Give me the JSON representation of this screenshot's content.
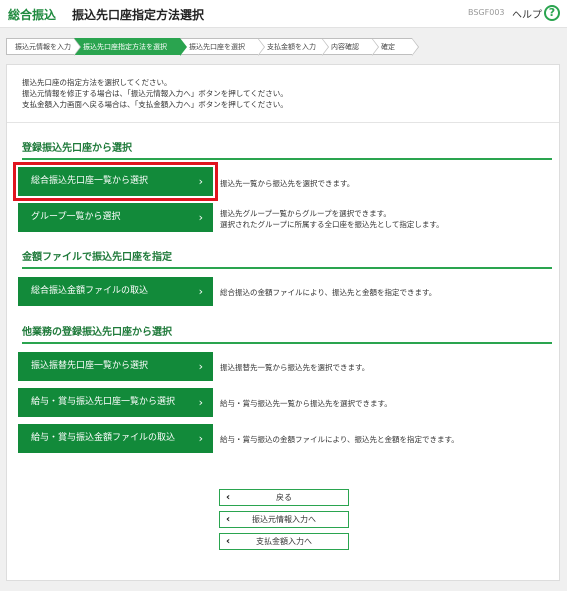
{
  "header": {
    "app_name": "総合振込",
    "page_title": "振込先口座指定方法選択",
    "screen_code": "BSGF003",
    "help_label": "ヘルプ",
    "help_icon": "?"
  },
  "steps": [
    {
      "label": "振込元情報を入力",
      "active": false
    },
    {
      "label": "振込先口座指定方法を選択",
      "active": true
    },
    {
      "label": "振込先口座を選択",
      "active": false
    },
    {
      "label": "支払金額を入力",
      "active": false
    },
    {
      "label": "内容確認",
      "active": false
    },
    {
      "label": "確定",
      "active": false
    }
  ],
  "intro": {
    "line1": "振込先口座の指定方法を選択してください。",
    "line2": "振込元情報を修正する場合は、「振込元情報入力へ」ボタンを押してください。",
    "line3": "支払金額入力画面へ戻る場合は、「支払金額入力へ」ボタンを押してください。"
  },
  "sections": {
    "registered": {
      "title": "登録振込先口座から選択",
      "btn_all": "総合振込先口座一覧から選択",
      "desc_all": "振込先一覧から振込先を選択できます。",
      "btn_group": "グループ一覧から選択",
      "desc_group_1": "振込先グループ一覧からグループを選択できます。",
      "desc_group_2": "選択されたグループに所属する全口座を振込先として指定します。"
    },
    "file": {
      "title": "金額ファイルで振込先口座を指定",
      "btn_file": "総合振込金額ファイルの取込",
      "desc_file": "総合振込の金額ファイルにより、振込先と金額を指定できます。"
    },
    "other": {
      "title": "他業務の登録振込先口座から選択",
      "btn_transfer": "振込振替先口座一覧から選択",
      "desc_transfer": "振込振替先一覧から振込先を選択できます。",
      "btn_salary": "給与・賞与振込先口座一覧から選択",
      "desc_salary": "給与・賞与振込先一覧から振込先を選択できます。",
      "btn_salary_file": "給与・賞与振込金額ファイルの取込",
      "desc_salary_file": "給与・賞与振込の金額ファイルにより、振込先と金額を指定できます。"
    }
  },
  "footer_buttons": {
    "back": "戻る",
    "to_source": "振込元情報入力へ",
    "to_amount": "支払金額入力へ"
  },
  "chevron_right": "›",
  "chevron_left": "‹"
}
